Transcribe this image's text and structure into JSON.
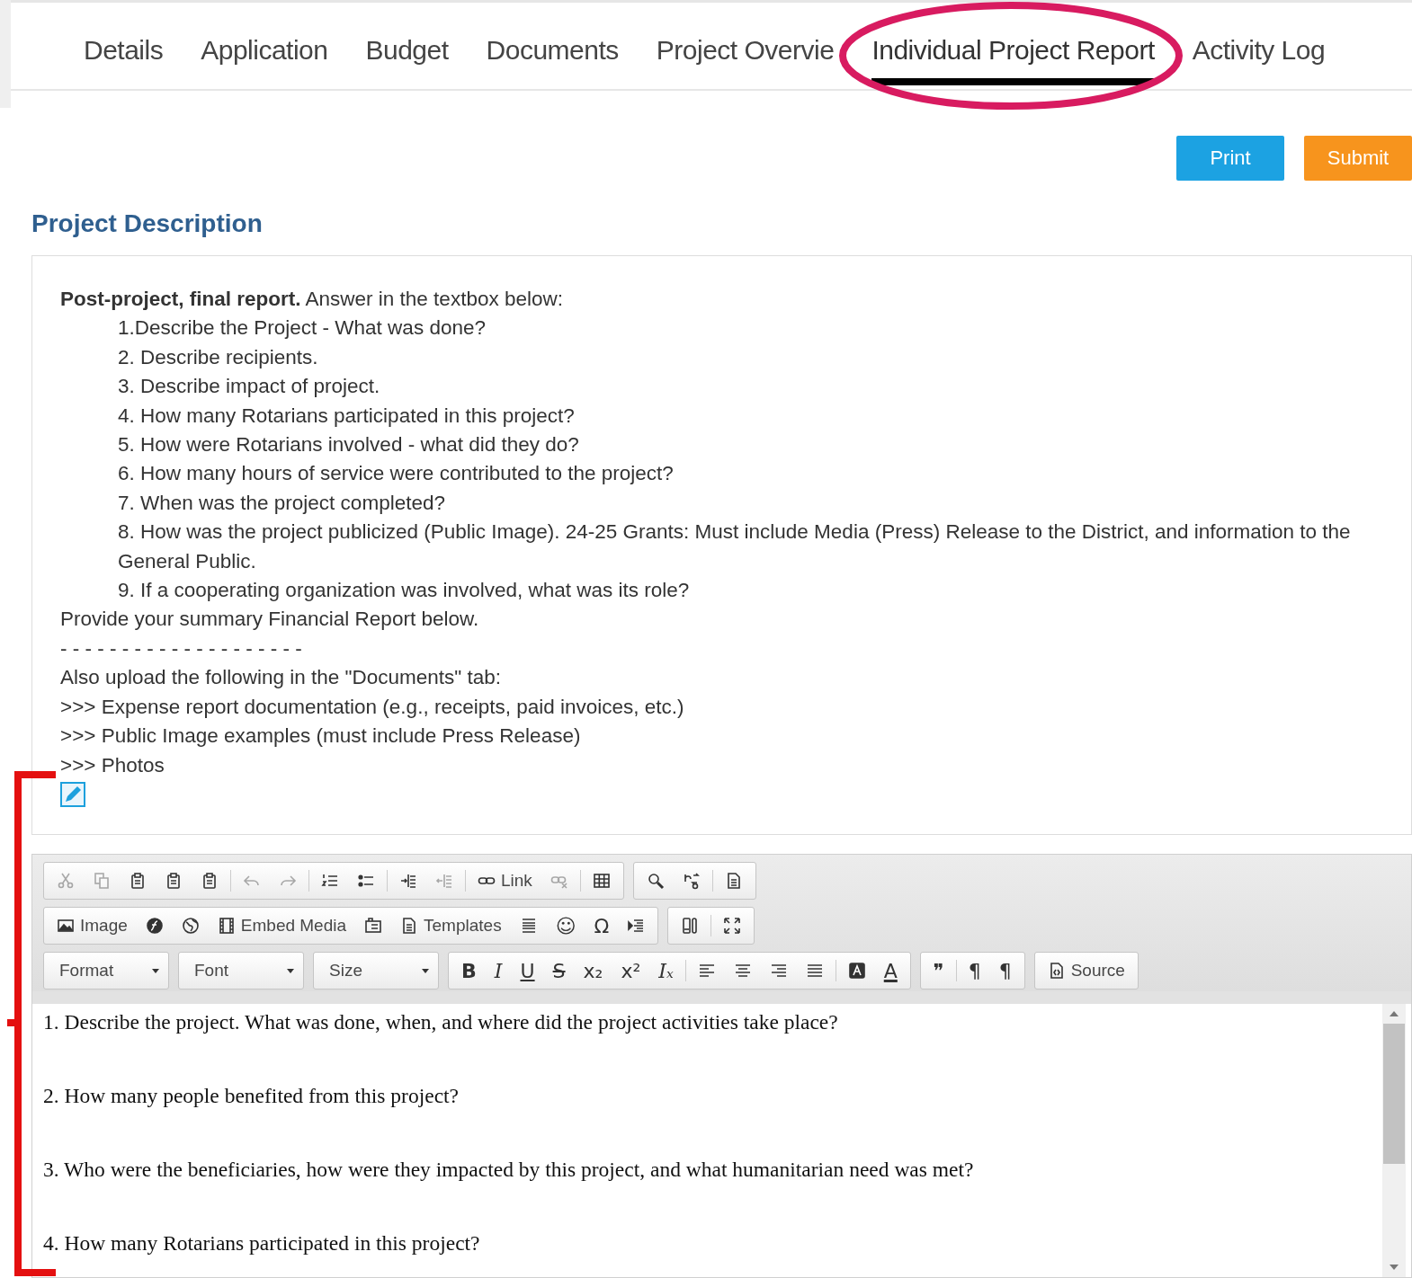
{
  "tabs": [
    {
      "label": "Details",
      "selected": false
    },
    {
      "label": "Application",
      "selected": false
    },
    {
      "label": "Budget",
      "selected": false
    },
    {
      "label": "Documents",
      "selected": false
    },
    {
      "label": "Project Overvie",
      "selected": false
    },
    {
      "label": "Individual Project Report",
      "selected": true
    },
    {
      "label": "Activity Log",
      "selected": false
    }
  ],
  "actions": [
    {
      "label": "Print",
      "kind": "print"
    },
    {
      "label": "Submit",
      "kind": "submit"
    }
  ],
  "section_title": "Project Description",
  "instructions": [
    {
      "kind": "plain",
      "text": "**Post-project, final report.**  Answer in the textbox below:"
    },
    {
      "kind": "indent",
      "text": "1.Describe the Project - What was done?"
    },
    {
      "kind": "indent",
      "text": "2. Describe recipients."
    },
    {
      "kind": "indent",
      "text": "3. Describe impact of project."
    },
    {
      "kind": "indent",
      "text": "4. How many Rotarians participated in this project?"
    },
    {
      "kind": "indent",
      "text": "5. How were Rotarians involved - what did they do?"
    },
    {
      "kind": "indent",
      "text": "6. How many hours of service were contributed to the project?"
    },
    {
      "kind": "indent",
      "text": "7. When was the project completed?"
    },
    {
      "kind": "indent",
      "text": "8. How was the project publicized (Public Image).  24-25 Grants: Must include Media (Press) Release to the District, and information to the General Public."
    },
    {
      "kind": "indent",
      "text": "9. If a cooperating organization was involved, what was its role?"
    },
    {
      "kind": "plain",
      "text": "Provide your summary Financial Report below."
    },
    {
      "kind": "plain",
      "text": "- - - - - - - - - - - - - - - - - - - -"
    },
    {
      "kind": "plain",
      "text": "Also upload the following in the \"Documents\" tab:"
    },
    {
      "kind": "plain",
      "text": ">>> Expense report documentation (e.g., receipts, paid invoices, etc.)"
    },
    {
      "kind": "plain",
      "text": ">>> Public Image examples (must include Press Release)"
    },
    {
      "kind": "plain",
      "text": ">>> Photos"
    }
  ],
  "toolbar": [
    [
      [
        {
          "kind": "icon",
          "disabled": true
        },
        {
          "kind": "icon",
          "disabled": true
        },
        {
          "kind": "icon",
          "disabled": false
        },
        {
          "kind": "icon",
          "disabled": false
        },
        {
          "kind": "icon",
          "disabled": false
        },
        {
          "kind": "sep"
        },
        {
          "kind": "icon",
          "disabled": true
        },
        {
          "kind": "icon",
          "disabled": true
        },
        {
          "kind": "sep"
        },
        {
          "kind": "icon",
          "disabled": false
        },
        {
          "kind": "icon",
          "disabled": false
        },
        {
          "kind": "sep"
        },
        {
          "kind": "icon",
          "disabled": false
        },
        {
          "kind": "icon",
          "disabled": true
        },
        {
          "kind": "sep"
        },
        {
          "kind": "labeled",
          "label": "Link",
          "disabled": false
        },
        {
          "kind": "icon",
          "disabled": true
        },
        {
          "kind": "sep"
        },
        {
          "kind": "icon",
          "disabled": false
        }
      ],
      [
        {
          "kind": "icon",
          "disabled": false
        },
        {
          "kind": "icon",
          "disabled": false
        },
        {
          "kind": "sep"
        },
        {
          "kind": "icon",
          "disabled": false
        }
      ]
    ],
    [
      [
        {
          "kind": "labeled",
          "label": "Image",
          "disabled": false
        },
        {
          "kind": "icon",
          "disabled": false
        },
        {
          "kind": "icon",
          "disabled": false
        },
        {
          "kind": "labeled",
          "label": "Embed Media",
          "disabled": false
        },
        {
          "kind": "icon",
          "disabled": false
        },
        {
          "kind": "labeled",
          "label": "Templates",
          "disabled": false
        },
        {
          "kind": "icon",
          "disabled": false
        },
        {
          "kind": "glyph",
          "glyph": "☺",
          "disabled": false
        },
        {
          "kind": "glyph",
          "glyph": "Ω",
          "disabled": false
        },
        {
          "kind": "icon",
          "disabled": false
        }
      ],
      [
        {
          "kind": "icon",
          "disabled": false
        },
        {
          "kind": "sep"
        },
        {
          "kind": "icon",
          "disabled": false
        }
      ]
    ],
    [
      [
        {
          "kind": "combo",
          "label": "Format"
        }
      ],
      [
        {
          "kind": "combo",
          "label": "Font"
        }
      ],
      [
        {
          "kind": "combo",
          "label": "Size"
        }
      ],
      [
        {
          "kind": "glyph",
          "glyph": "B",
          "disabled": false
        },
        {
          "kind": "glyph",
          "glyph": "I",
          "disabled": false
        },
        {
          "kind": "glyph",
          "glyph": "U",
          "disabled": false
        },
        {
          "kind": "glyph",
          "glyph": "S",
          "disabled": false
        },
        {
          "kind": "glyph",
          "glyph": "x₂",
          "disabled": false
        },
        {
          "kind": "glyph",
          "glyph": "x²",
          "disabled": false
        },
        {
          "kind": "glyph",
          "glyph": "Iₓ",
          "disabled": false
        },
        {
          "kind": "sep"
        },
        {
          "kind": "icon",
          "disabled": false
        },
        {
          "kind": "icon",
          "disabled": false
        },
        {
          "kind": "icon",
          "disabled": false
        },
        {
          "kind": "icon",
          "disabled": false
        },
        {
          "kind": "sep"
        },
        {
          "kind": "icon",
          "disabled": false
        },
        {
          "kind": "glyph",
          "glyph": "A",
          "disabled": false
        }
      ],
      [
        {
          "kind": "glyph",
          "glyph": "❞",
          "disabled": false
        },
        {
          "kind": "sep"
        },
        {
          "kind": "glyph",
          "glyph": "¶",
          "disabled": false
        },
        {
          "kind": "glyph",
          "glyph": "¶",
          "disabled": false
        }
      ],
      [
        {
          "kind": "labeled",
          "label": "Source",
          "disabled": false
        }
      ]
    ]
  ],
  "editor_paragraphs": [
    "1. Describe the project. What was done, when, and where did the project activities take place?",
    "2. How many people benefited from this project?",
    "3. Who were the beneficiaries, how were they impacted by this project, and what humanitarian need was met?",
    "4. How many Rotarians participated in this project?"
  ]
}
